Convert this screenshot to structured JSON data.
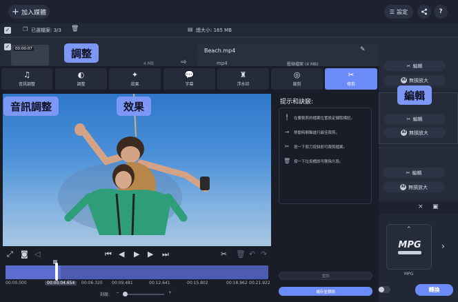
{
  "toolbar": {
    "add_media_label": "加入媒體",
    "settings_label": "設定",
    "help_label": "?"
  },
  "filebar": {
    "selected_label": "已選檔案: 3/3",
    "total_size_label": "總大小: 165 MB"
  },
  "file_items": [
    {
      "duration": "00:00:07",
      "size": "4 MB",
      "edit_label": "編輯",
      "ai_label": "無損放大"
    },
    {
      "edit_label": "編輯",
      "ai_label": "無損放大"
    },
    {
      "edit_label": "編輯",
      "ai_label": "無損放大"
    }
  ],
  "beach": {
    "filename": "Beach.mp4",
    "format": "mp4",
    "target": "壓縮檔案 (4 MB)"
  },
  "tabs": [
    {
      "label": "音訊調整",
      "icon": "music-note-icon"
    },
    {
      "label": "調整",
      "icon": "contrast-icon"
    },
    {
      "label": "效果",
      "icon": "magic-wand-icon"
    },
    {
      "label": "字幕",
      "icon": "subtitle-icon"
    },
    {
      "label": "浮水印",
      "icon": "stamp-icon"
    },
    {
      "label": "裁剪",
      "icon": "crop-icon"
    },
    {
      "label": "修剪",
      "icon": "scissors-icon"
    }
  ],
  "tips": {
    "title": "提示和訣竅:",
    "items": [
      {
        "text": "在要裁剪的檔案位置設定擷取標記。",
        "icon": "marker-icon"
      },
      {
        "text": "移動時間軸進行最佳裁剪。",
        "icon": "arrow-right-icon"
      },
      {
        "text": "按一下剪刀按鈕即可裁剪檔案。",
        "icon": "scissors-icon"
      },
      {
        "text": "按一下垃圾桶即可刪除片段。",
        "icon": "trash-icon"
      }
    ],
    "reset_label": "重設",
    "save_close_label": "儲存並關閉"
  },
  "timeline": {
    "ticks": [
      "00:00.000",
      "00:00:04.654",
      "00:06.320",
      "00:09.481",
      "00:12.641",
      "00:15.802",
      "00:18.962",
      "00:21.922"
    ],
    "zoom_label": "刻度:",
    "zoom_minus": "−",
    "zoom_plus": "+"
  },
  "annotations": {
    "adjust": "調整",
    "audio": "音訊調整",
    "effects": "效果",
    "edit": "編輯"
  },
  "output": {
    "format_name": "MPG",
    "format_label": "MPG",
    "convert_label": "轉換"
  },
  "colors": {
    "accent": "#6b8cf8",
    "callout": "#7d97f5",
    "background": "#1b1f2a"
  }
}
